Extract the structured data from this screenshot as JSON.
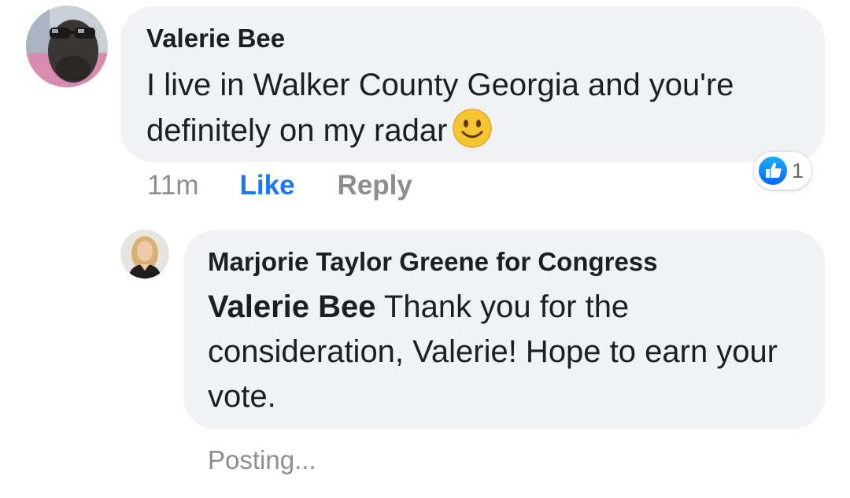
{
  "comment": {
    "author": "Valerie Bee",
    "text": "I live in Walker County Georgia and you're definitely on my radar",
    "emoji_icon": "slightly-smiling-face-icon",
    "timestamp": "11m",
    "like_label": "Like",
    "reply_label": "Reply",
    "reaction_icon": "like-reaction-icon",
    "reaction_count": "1"
  },
  "reply": {
    "author": "Marjorie Taylor Greene for Congress",
    "mention": "Valerie Bee",
    "text": " Thank you for the consideration, Valerie! Hope to earn your vote.",
    "status": "Posting..."
  },
  "colors": {
    "bubble": "#f0f2f5",
    "link_blue": "#1877f2",
    "muted": "#8a8d91",
    "text": "#1c1e21"
  }
}
